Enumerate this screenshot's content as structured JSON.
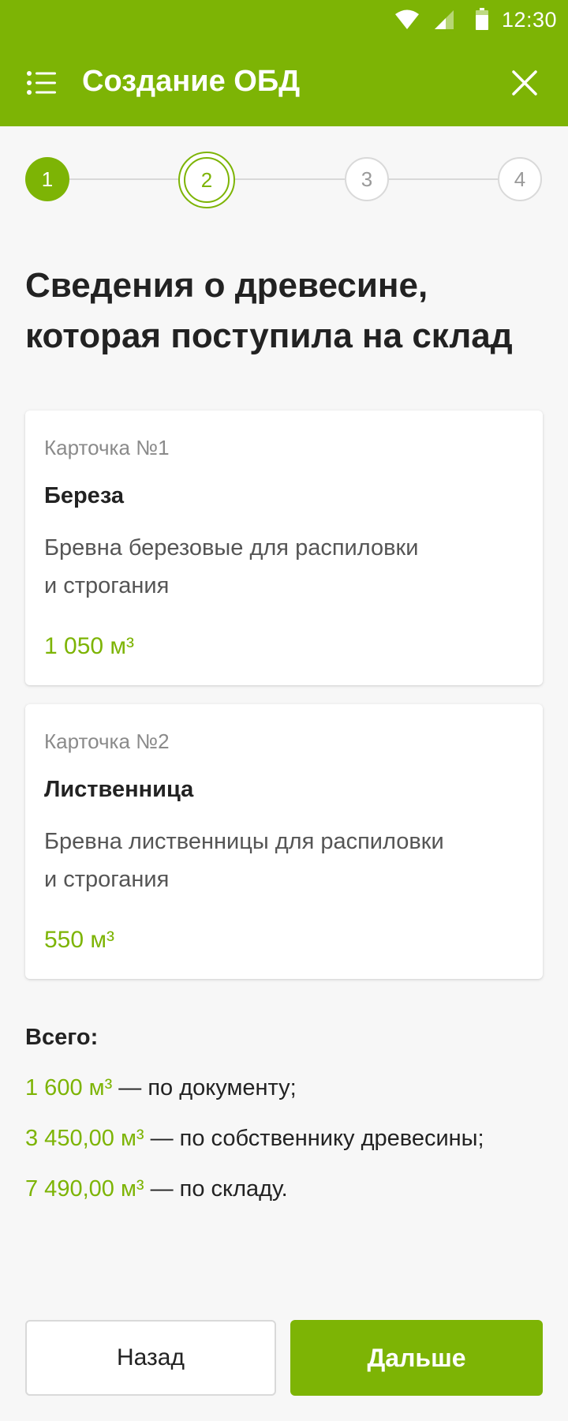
{
  "status_bar": {
    "time": "12:30",
    "icons": [
      "wifi-icon",
      "signal-icon",
      "battery-icon"
    ]
  },
  "app_bar": {
    "title": "Создание ОБД",
    "menu_icon": "menu-list-icon",
    "close_icon": "close-icon"
  },
  "stepper": {
    "current": 2,
    "steps": [
      {
        "label": "1",
        "state": "completed"
      },
      {
        "label": "2",
        "state": "current"
      },
      {
        "label": "3",
        "state": "pending"
      },
      {
        "label": "4",
        "state": "pending"
      }
    ]
  },
  "page": {
    "title_line1": "Сведения о древесине,",
    "title_line2": "которая поступила на склад"
  },
  "cards": [
    {
      "number": "Карточка №1",
      "name": "Береза",
      "desc_line1": "Бревна березовые для распиловки",
      "desc_line2": "и строгания",
      "volume": "1 050 м³"
    },
    {
      "number": "Карточка №2",
      "name": "Лиственница",
      "desc_line1": "Бревна лиственницы для распиловки",
      "desc_line2": "и строгания",
      "volume": "550 м³"
    }
  ],
  "totals": {
    "label": "Всего:",
    "rows": [
      {
        "amount": "1 600 м³",
        "text": " — по документу;"
      },
      {
        "amount": "3 450,00 м³",
        "text": " — по собственнику древесины;"
      },
      {
        "amount": "7 490,00 м³",
        "text": " — по складу."
      }
    ]
  },
  "buttons": {
    "back": "Назад",
    "next": "Дальше"
  },
  "colors": {
    "accent": "#7db405",
    "background": "#f7f7f7",
    "text": "#222222",
    "muted": "#8a8a8a"
  }
}
